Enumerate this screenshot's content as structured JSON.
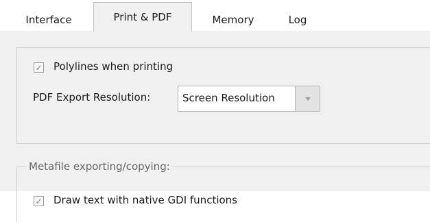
{
  "tabs": [
    {
      "label": "Interface"
    },
    {
      "label": "Print & PDF"
    },
    {
      "label": "Memory"
    },
    {
      "label": "Log"
    }
  ],
  "print_section": {
    "polylines_checked": true,
    "polylines_label": "Polylines when printing",
    "pdf_resolution_label": "PDF Export Resolution:",
    "pdf_resolution_value": "Screen Resolution"
  },
  "metafile_section": {
    "title": "Metafile exporting/copying:",
    "gdi_checked": true,
    "gdi_label": "Draw text with native GDI functions"
  },
  "icons": {
    "check": "checkmark-icon",
    "dropdown": "chevron-down-icon"
  }
}
